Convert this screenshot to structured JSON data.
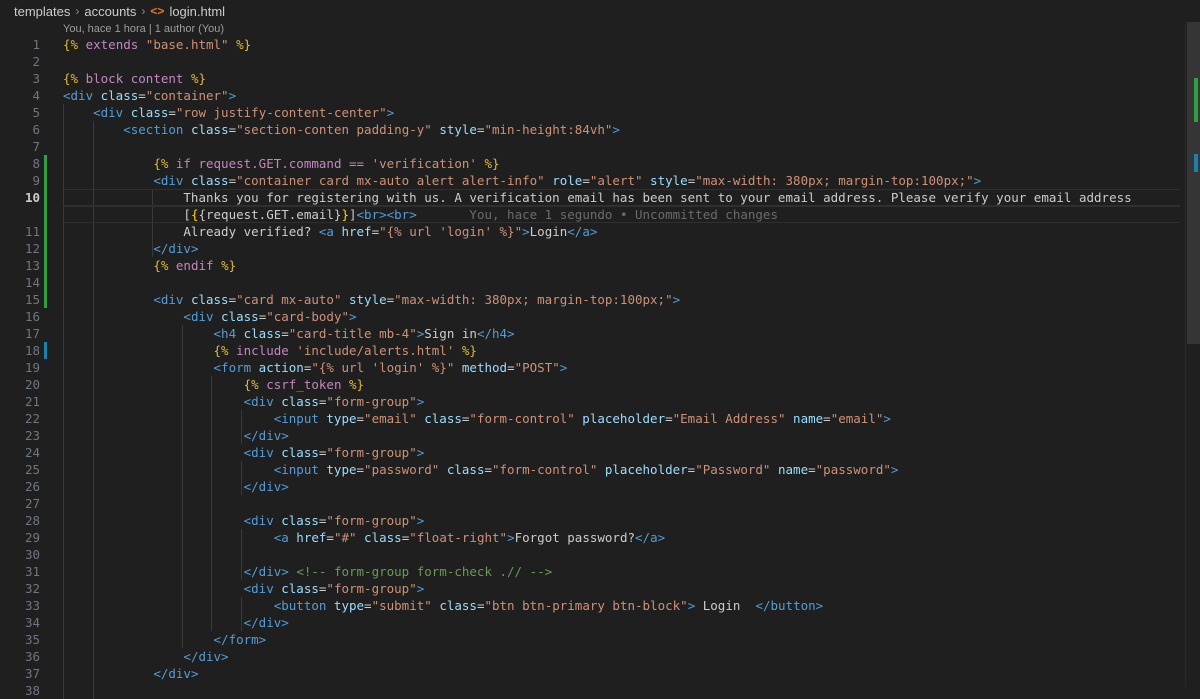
{
  "breadcrumb": {
    "items": [
      "templates",
      "accounts",
      "login.html"
    ],
    "separator": "›"
  },
  "codelens": "You, hace 1 hora | 1 author (You)",
  "lines": [
    {
      "n": "1",
      "tokens": [
        [
          "{%",
          "delim"
        ],
        [
          " extends ",
          "tpl"
        ],
        [
          "\"base.html\"",
          "str"
        ],
        [
          " %}",
          "delim"
        ]
      ]
    },
    {
      "n": "2",
      "tokens": []
    },
    {
      "n": "3",
      "tokens": [
        [
          "{%",
          "delim"
        ],
        [
          " block content ",
          "tpl"
        ],
        [
          "%}",
          "delim"
        ]
      ]
    },
    {
      "n": "4",
      "tokens": [
        [
          "<div",
          "tag"
        ],
        [
          " class",
          "attr"
        ],
        [
          "=",
          "text"
        ],
        [
          "\"container\"",
          "str"
        ],
        [
          ">",
          "tag"
        ]
      ]
    },
    {
      "n": "5",
      "tokens": [
        [
          "    ",
          "text"
        ],
        [
          "<div",
          "tag"
        ],
        [
          " class",
          "attr"
        ],
        [
          "=",
          "text"
        ],
        [
          "\"row justify-content-center\"",
          "str"
        ],
        [
          ">",
          "tag"
        ]
      ]
    },
    {
      "n": "6",
      "tokens": [
        [
          "        ",
          "text"
        ],
        [
          "<section",
          "tag"
        ],
        [
          " class",
          "attr"
        ],
        [
          "=",
          "text"
        ],
        [
          "\"section-conten padding-y\"",
          "str"
        ],
        [
          " style",
          "attr"
        ],
        [
          "=",
          "text"
        ],
        [
          "\"min-height:84vh\"",
          "str"
        ],
        [
          ">",
          "tag"
        ]
      ]
    },
    {
      "n": "7",
      "tokens": []
    },
    {
      "n": "8",
      "tokens": [
        [
          "            ",
          "text"
        ],
        [
          "{%",
          "delim"
        ],
        [
          " if request.GET.command == ",
          "tpl"
        ],
        [
          "'verification'",
          "str"
        ],
        [
          " %}",
          "delim"
        ]
      ]
    },
    {
      "n": "9",
      "tokens": [
        [
          "            ",
          "text"
        ],
        [
          "<div",
          "tag"
        ],
        [
          " class",
          "attr"
        ],
        [
          "=",
          "text"
        ],
        [
          "\"container card mx-auto alert alert-info\"",
          "str"
        ],
        [
          " role",
          "attr"
        ],
        [
          "=",
          "text"
        ],
        [
          "\"alert\"",
          "str"
        ],
        [
          " style",
          "attr"
        ],
        [
          "=",
          "text"
        ],
        [
          "\"max-width: 380px; margin-top:100px;\"",
          "str"
        ],
        [
          ">",
          "tag"
        ]
      ]
    },
    {
      "n": "10",
      "tokens": [
        [
          "                Thanks you for registering with us. A verification email has been sent to your email address. Please verify your email address",
          "text"
        ]
      ]
    },
    {
      "n": "",
      "tokens": [
        [
          "                [",
          "text"
        ],
        [
          "{",
          "bracket"
        ],
        [
          "{request.GET.email}",
          "text"
        ],
        [
          "}",
          "bracket"
        ],
        [
          "]",
          "text"
        ],
        [
          "<br><br>",
          "tag"
        ],
        [
          "       You, hace 1 segundo • Uncommitted changes",
          "blame"
        ]
      ]
    },
    {
      "n": "11",
      "tokens": [
        [
          "                Already verified? ",
          "text"
        ],
        [
          "<a",
          "tag"
        ],
        [
          " href",
          "attr"
        ],
        [
          "=",
          "text"
        ],
        [
          "\"{% url 'login' %}\"",
          "str"
        ],
        [
          ">",
          "tag"
        ],
        [
          "Login",
          "text"
        ],
        [
          "</a>",
          "tag"
        ]
      ]
    },
    {
      "n": "12",
      "tokens": [
        [
          "            ",
          "text"
        ],
        [
          "</div>",
          "tag"
        ]
      ]
    },
    {
      "n": "13",
      "tokens": [
        [
          "            ",
          "text"
        ],
        [
          "{%",
          "delim"
        ],
        [
          " endif ",
          "tpl"
        ],
        [
          "%}",
          "delim"
        ]
      ]
    },
    {
      "n": "14",
      "tokens": []
    },
    {
      "n": "15",
      "tokens": [
        [
          "            ",
          "text"
        ],
        [
          "<div",
          "tag"
        ],
        [
          " class",
          "attr"
        ],
        [
          "=",
          "text"
        ],
        [
          "\"card mx-auto\"",
          "str"
        ],
        [
          " style",
          "attr"
        ],
        [
          "=",
          "text"
        ],
        [
          "\"max-width: 380px; margin-top:100px;\"",
          "str"
        ],
        [
          ">",
          "tag"
        ]
      ]
    },
    {
      "n": "16",
      "tokens": [
        [
          "                ",
          "text"
        ],
        [
          "<div",
          "tag"
        ],
        [
          " class",
          "attr"
        ],
        [
          "=",
          "text"
        ],
        [
          "\"card-body\"",
          "str"
        ],
        [
          ">",
          "tag"
        ]
      ]
    },
    {
      "n": "17",
      "tokens": [
        [
          "                    ",
          "text"
        ],
        [
          "<h4",
          "tag"
        ],
        [
          " class",
          "attr"
        ],
        [
          "=",
          "text"
        ],
        [
          "\"card-title mb-4\"",
          "str"
        ],
        [
          ">",
          "tag"
        ],
        [
          "Sign in",
          "text"
        ],
        [
          "</h4>",
          "tag"
        ]
      ]
    },
    {
      "n": "18",
      "tokens": [
        [
          "                    ",
          "text"
        ],
        [
          "{%",
          "delim"
        ],
        [
          " include ",
          "tpl"
        ],
        [
          "'include/alerts.html'",
          "str"
        ],
        [
          " %}",
          "delim"
        ]
      ]
    },
    {
      "n": "19",
      "tokens": [
        [
          "                    ",
          "text"
        ],
        [
          "<form",
          "tag"
        ],
        [
          " action",
          "attr"
        ],
        [
          "=",
          "text"
        ],
        [
          "\"{% url 'login' %}\"",
          "str"
        ],
        [
          " method",
          "attr"
        ],
        [
          "=",
          "text"
        ],
        [
          "\"POST\"",
          "str"
        ],
        [
          ">",
          "tag"
        ]
      ]
    },
    {
      "n": "20",
      "tokens": [
        [
          "                        ",
          "text"
        ],
        [
          "{%",
          "delim"
        ],
        [
          " csrf_token ",
          "tpl"
        ],
        [
          "%}",
          "delim"
        ]
      ]
    },
    {
      "n": "21",
      "tokens": [
        [
          "                        ",
          "text"
        ],
        [
          "<div",
          "tag"
        ],
        [
          " class",
          "attr"
        ],
        [
          "=",
          "text"
        ],
        [
          "\"form-group\"",
          "str"
        ],
        [
          ">",
          "tag"
        ]
      ]
    },
    {
      "n": "22",
      "tokens": [
        [
          "                            ",
          "text"
        ],
        [
          "<input",
          "tag"
        ],
        [
          " type",
          "attr"
        ],
        [
          "=",
          "text"
        ],
        [
          "\"email\"",
          "str"
        ],
        [
          " class",
          "attr"
        ],
        [
          "=",
          "text"
        ],
        [
          "\"form-control\"",
          "str"
        ],
        [
          " placeholder",
          "attr"
        ],
        [
          "=",
          "text"
        ],
        [
          "\"Email Address\"",
          "str"
        ],
        [
          " name",
          "attr"
        ],
        [
          "=",
          "text"
        ],
        [
          "\"email\"",
          "str"
        ],
        [
          ">",
          "tag"
        ]
      ]
    },
    {
      "n": "23",
      "tokens": [
        [
          "                        ",
          "text"
        ],
        [
          "</div>",
          "tag"
        ]
      ]
    },
    {
      "n": "24",
      "tokens": [
        [
          "                        ",
          "text"
        ],
        [
          "<div",
          "tag"
        ],
        [
          " class",
          "attr"
        ],
        [
          "=",
          "text"
        ],
        [
          "\"form-group\"",
          "str"
        ],
        [
          ">",
          "tag"
        ]
      ]
    },
    {
      "n": "25",
      "tokens": [
        [
          "                            ",
          "text"
        ],
        [
          "<input",
          "tag"
        ],
        [
          " type",
          "attr"
        ],
        [
          "=",
          "text"
        ],
        [
          "\"password\"",
          "str"
        ],
        [
          " class",
          "attr"
        ],
        [
          "=",
          "text"
        ],
        [
          "\"form-control\"",
          "str"
        ],
        [
          " placeholder",
          "attr"
        ],
        [
          "=",
          "text"
        ],
        [
          "\"Password\"",
          "str"
        ],
        [
          " name",
          "attr"
        ],
        [
          "=",
          "text"
        ],
        [
          "\"password\"",
          "str"
        ],
        [
          ">",
          "tag"
        ]
      ]
    },
    {
      "n": "26",
      "tokens": [
        [
          "                        ",
          "text"
        ],
        [
          "</div>",
          "tag"
        ]
      ]
    },
    {
      "n": "27",
      "tokens": []
    },
    {
      "n": "28",
      "tokens": [
        [
          "                        ",
          "text"
        ],
        [
          "<div",
          "tag"
        ],
        [
          " class",
          "attr"
        ],
        [
          "=",
          "text"
        ],
        [
          "\"form-group\"",
          "str"
        ],
        [
          ">",
          "tag"
        ]
      ]
    },
    {
      "n": "29",
      "tokens": [
        [
          "                            ",
          "text"
        ],
        [
          "<a",
          "tag"
        ],
        [
          " href",
          "attr"
        ],
        [
          "=",
          "text"
        ],
        [
          "\"#\"",
          "str"
        ],
        [
          " class",
          "attr"
        ],
        [
          "=",
          "text"
        ],
        [
          "\"float-right\"",
          "str"
        ],
        [
          ">",
          "tag"
        ],
        [
          "Forgot password?",
          "text"
        ],
        [
          "</a>",
          "tag"
        ]
      ]
    },
    {
      "n": "30",
      "tokens": []
    },
    {
      "n": "31",
      "tokens": [
        [
          "                        ",
          "text"
        ],
        [
          "</div>",
          "tag"
        ],
        [
          " ",
          "text"
        ],
        [
          "<!-- form-group form-check .// -->",
          "comment"
        ]
      ]
    },
    {
      "n": "32",
      "tokens": [
        [
          "                        ",
          "text"
        ],
        [
          "<div",
          "tag"
        ],
        [
          " class",
          "attr"
        ],
        [
          "=",
          "text"
        ],
        [
          "\"form-group\"",
          "str"
        ],
        [
          ">",
          "tag"
        ]
      ]
    },
    {
      "n": "33",
      "tokens": [
        [
          "                            ",
          "text"
        ],
        [
          "<button",
          "tag"
        ],
        [
          " type",
          "attr"
        ],
        [
          "=",
          "text"
        ],
        [
          "\"submit\"",
          "str"
        ],
        [
          " class",
          "attr"
        ],
        [
          "=",
          "text"
        ],
        [
          "\"btn btn-primary btn-block\"",
          "str"
        ],
        [
          ">",
          "tag"
        ],
        [
          " Login  ",
          "text"
        ],
        [
          "</button>",
          "tag"
        ]
      ]
    },
    {
      "n": "34",
      "tokens": [
        [
          "                        ",
          "text"
        ],
        [
          "</div>",
          "tag"
        ]
      ]
    },
    {
      "n": "35",
      "tokens": [
        [
          "                    ",
          "text"
        ],
        [
          "</form>",
          "tag"
        ]
      ]
    },
    {
      "n": "36",
      "tokens": [
        [
          "                ",
          "text"
        ],
        [
          "</div>",
          "tag"
        ]
      ]
    },
    {
      "n": "37",
      "tokens": [
        [
          "            ",
          "text"
        ],
        [
          "</div>",
          "tag"
        ]
      ]
    },
    {
      "n": "38",
      "tokens": []
    }
  ]
}
